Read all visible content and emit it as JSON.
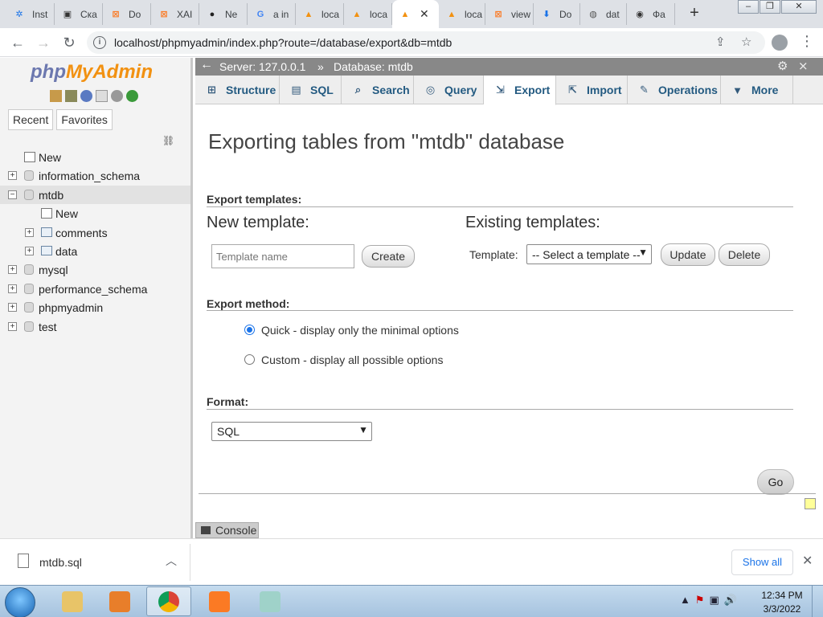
{
  "browser": {
    "tabs": [
      {
        "label": "Inst",
        "icon": "settings-icon"
      },
      {
        "label": "Ска",
        "icon": "video-icon"
      },
      {
        "label": "Do",
        "icon": "xampp-icon"
      },
      {
        "label": "XAI",
        "icon": "xampp-icon"
      },
      {
        "label": "Ne",
        "icon": "github-icon"
      },
      {
        "label": "a in",
        "icon": "google-icon"
      },
      {
        "label": "loca",
        "icon": "phpmyadmin-icon"
      },
      {
        "label": "loca",
        "icon": "phpmyadmin-icon"
      },
      {
        "label": "",
        "icon": "phpmyadmin-icon",
        "active": true
      },
      {
        "label": "loca",
        "icon": "phpmyadmin-icon"
      },
      {
        "label": "view",
        "icon": "xampp-icon"
      },
      {
        "label": "Do",
        "icon": "download-icon"
      },
      {
        "label": "dat",
        "icon": "globe-icon"
      },
      {
        "label": "Фа",
        "icon": "eye-icon"
      }
    ],
    "url": "localhost/phpmyadmin/index.php?route=/database/export&db=mtdb"
  },
  "nav": {
    "logo_php": "php",
    "logo_myadmin": "MyAdmin",
    "recent_label": "Recent",
    "favorites_label": "Favorites",
    "tree": [
      {
        "label": "New",
        "level": 0,
        "type": "new"
      },
      {
        "label": "information_schema",
        "level": 0,
        "type": "db",
        "expander": "+"
      },
      {
        "label": "mtdb",
        "level": 0,
        "type": "db",
        "expander": "−",
        "selected": true
      },
      {
        "label": "New",
        "level": 1,
        "type": "new"
      },
      {
        "label": "comments",
        "level": 1,
        "type": "table",
        "expander": "+"
      },
      {
        "label": "data",
        "level": 1,
        "type": "table",
        "expander": "+"
      },
      {
        "label": "mysql",
        "level": 0,
        "type": "db",
        "expander": "+"
      },
      {
        "label": "performance_schema",
        "level": 0,
        "type": "db",
        "expander": "+"
      },
      {
        "label": "phpmyadmin",
        "level": 0,
        "type": "db",
        "expander": "+"
      },
      {
        "label": "test",
        "level": 0,
        "type": "db",
        "expander": "+"
      }
    ]
  },
  "breadcrumb": {
    "server": "Server: 127.0.0.1",
    "separator": "»",
    "database": "Database: mtdb"
  },
  "menu": [
    {
      "label": "Structure",
      "icon": "structure-icon"
    },
    {
      "label": "SQL",
      "icon": "sql-icon"
    },
    {
      "label": "Search",
      "icon": "search-icon"
    },
    {
      "label": "Query",
      "icon": "query-icon"
    },
    {
      "label": "Export",
      "icon": "export-icon",
      "active": true
    },
    {
      "label": "Import",
      "icon": "import-icon"
    },
    {
      "label": "Operations",
      "icon": "wrench-icon"
    },
    {
      "label": "More",
      "icon": "caret-down-icon"
    }
  ],
  "main": {
    "title": "Exporting tables from \"mtdb\" database",
    "templates": {
      "header": "Export templates:",
      "new_title": "New template:",
      "name_placeholder": "Template name",
      "create_label": "Create",
      "existing_title": "Existing templates:",
      "template_label": "Template:",
      "template_selected": "-- Select a template --",
      "update_label": "Update",
      "delete_label": "Delete"
    },
    "method": {
      "header": "Export method:",
      "quick": "Quick - display only the minimal options",
      "custom": "Custom - display all possible options",
      "selected": "quick"
    },
    "format": {
      "header": "Format:",
      "selected": "SQL"
    },
    "go_label": "Go",
    "console_label": "Console"
  },
  "downloads": {
    "file": "mtdb.sql",
    "show_all": "Show all"
  },
  "taskbar": {
    "time": "12:34 PM",
    "date": "3/3/2022"
  }
}
